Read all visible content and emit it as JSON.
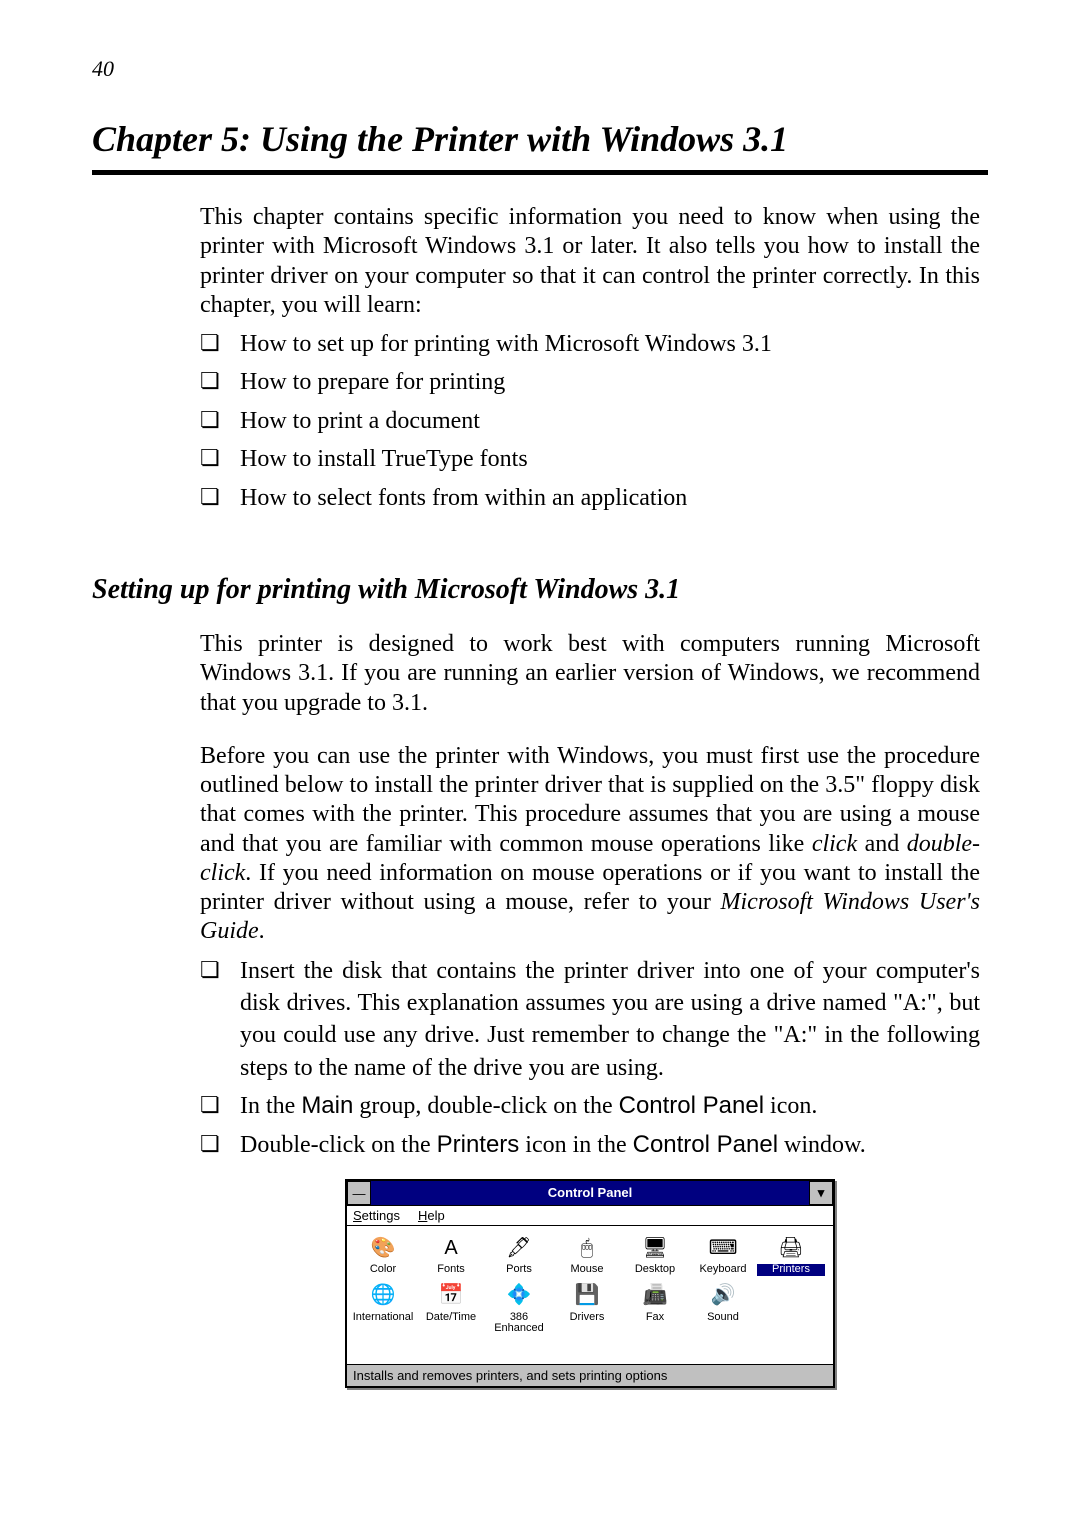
{
  "page_number": "40",
  "chapter_title": "Chapter 5:  Using the Printer with Windows 3.1",
  "intro_paragraph": "This chapter contains specific information you need to know when using the printer with Microsoft Windows 3.1 or later. It also tells you how to install the printer driver on your computer so that it can control the printer correctly. In this chapter, you will learn:",
  "intro_bullets": [
    "How to set up for printing with Microsoft Windows 3.1",
    "How to prepare for printing",
    "How to print a document",
    "How to install TrueType fonts",
    "How to select fonts from within an application"
  ],
  "subheading": "Setting up for printing with Microsoft Windows 3.1",
  "sub_para1": "This printer is designed to work best with computers running Microsoft Windows 3.1. If you are running an earlier version of Windows, we recommend that you upgrade to 3.1.",
  "sub_para2_a": "Before you can use the printer with Windows, you must first use the procedure outlined below to install the printer driver that is supplied on the 3.5\" floppy disk that comes with the printer. This procedure assumes that you are using a mouse and that you are familiar with common mouse operations like ",
  "sub_para2_click": "click",
  "sub_para2_mid": " and ",
  "sub_para2_dbl": "double-click",
  "sub_para2_b": ". If you need information on mouse operations or if you want to install the printer driver without using a mouse, refer to your ",
  "sub_para2_guide": "Microsoft Windows User's Guide",
  "sub_para2_end": ".",
  "step1": "Insert the disk that contains the printer driver into one of your computer's disk drives. This explanation assumes you are using a drive named \"A:\", but you could use any drive. Just remember to change the \"A:\" in the following steps to the name of the drive you are using.",
  "step2_a": "In the ",
  "step2_main": "Main",
  "step2_b": " group, double-click on the ",
  "step2_cp": "Control Panel",
  "step2_c": " icon.",
  "step3_a": "Double-click on the ",
  "step3_printers": "Printers",
  "step3_b": " icon in the ",
  "step3_cp": "Control Panel",
  "step3_c": " window.",
  "cp": {
    "title": "Control Panel",
    "menu_settings_u": "S",
    "menu_settings_rest": "ettings",
    "menu_help_u": "H",
    "menu_help_rest": "elp",
    "status": "Installs and removes printers, and sets printing options",
    "min_glyph": "▾",
    "sys_glyph": "—",
    "items": [
      {
        "label": "Color",
        "glyph": "🎨"
      },
      {
        "label": "Fonts",
        "glyph": "A"
      },
      {
        "label": "Ports",
        "glyph": "🖋"
      },
      {
        "label": "Mouse",
        "glyph": "🖱"
      },
      {
        "label": "Desktop",
        "glyph": "🖥"
      },
      {
        "label": "Keyboard",
        "glyph": "⌨"
      },
      {
        "label": "Printers",
        "glyph": "🖨"
      },
      {
        "label": "International",
        "glyph": "🌐"
      },
      {
        "label": "Date/Time",
        "glyph": "📅"
      },
      {
        "label": "386 Enhanced",
        "glyph": "💠"
      },
      {
        "label": "Drivers",
        "glyph": "💾"
      },
      {
        "label": "Fax",
        "glyph": "📠"
      },
      {
        "label": "Sound",
        "glyph": "🔊"
      }
    ],
    "selected_index": 6
  }
}
